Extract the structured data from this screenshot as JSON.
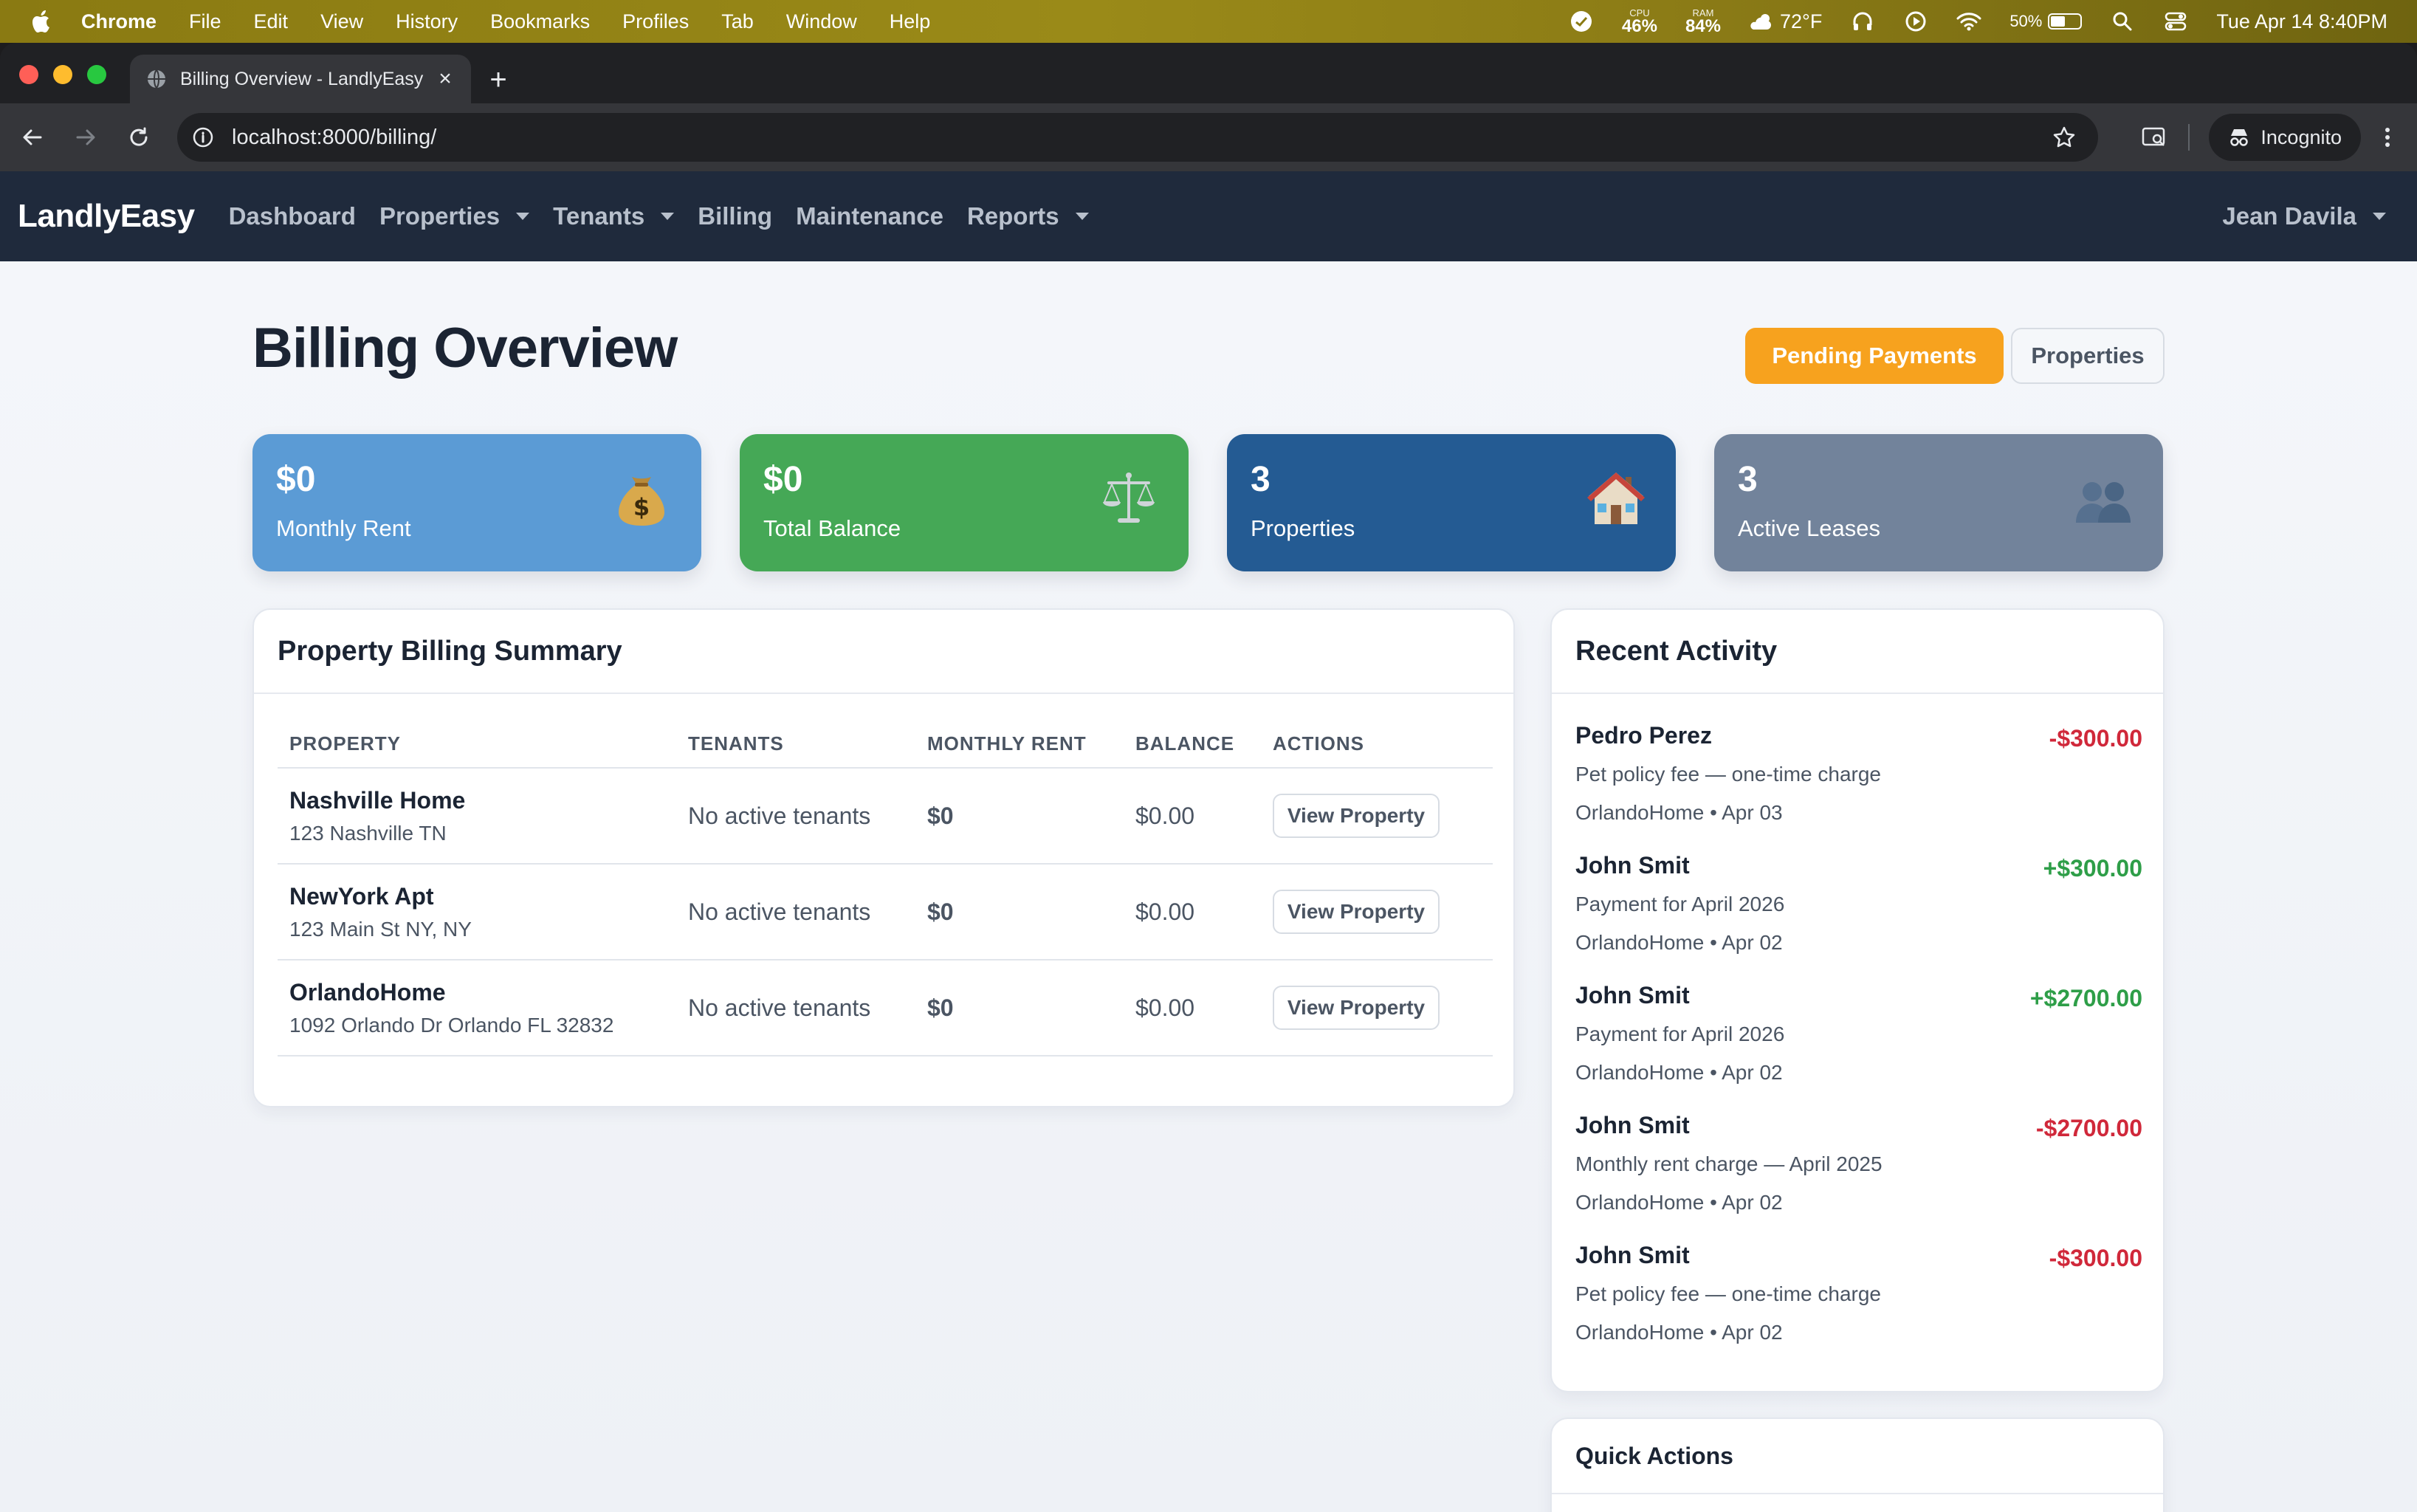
{
  "menubar": {
    "app": "Chrome",
    "items": [
      "File",
      "Edit",
      "View",
      "History",
      "Bookmarks",
      "Profiles",
      "Tab",
      "Window",
      "Help"
    ],
    "cpu_label": "CPU",
    "cpu_value": "46%",
    "ram_label": "RAM",
    "ram_value": "84%",
    "weather": "72°F",
    "battery": "50%",
    "battery_level": 0.5,
    "clock": "Tue Apr 14  8:40PM"
  },
  "browser": {
    "tab_title": "Billing Overview - LandlyEasy",
    "url": "localhost:8000/billing/",
    "incognito_label": "Incognito"
  },
  "nav": {
    "brand": "LandlyEasy",
    "links": {
      "dashboard": "Dashboard",
      "properties": "Properties",
      "tenants": "Tenants",
      "billing": "Billing",
      "maintenance": "Maintenance",
      "reports": "Reports"
    },
    "user": "Jean Davila"
  },
  "page": {
    "title": "Billing Overview",
    "pending_button": "Pending Payments",
    "properties_button": "Properties"
  },
  "stats": {
    "monthly_rent": {
      "value": "$0",
      "label": "Monthly Rent",
      "icon": "money-bag-icon"
    },
    "total_balance": {
      "value": "$0",
      "label": "Total Balance",
      "icon": "scales-icon"
    },
    "properties": {
      "value": "3",
      "label": "Properties",
      "icon": "house-icon"
    },
    "active_leases": {
      "value": "3",
      "label": "Active Leases",
      "icon": "people-icon"
    }
  },
  "summary": {
    "title": "Property Billing Summary",
    "columns": [
      "PROPERTY",
      "TENANTS",
      "MONTHLY RENT",
      "BALANCE",
      "ACTIONS"
    ],
    "rows": [
      {
        "name": "Nashville Home",
        "address": "123 Nashville TN",
        "tenants": "No active tenants",
        "rent": "$0",
        "balance": "$0.00",
        "action": "View Property"
      },
      {
        "name": "NewYork Apt",
        "address": "123 Main St NY, NY",
        "tenants": "No active tenants",
        "rent": "$0",
        "balance": "$0.00",
        "action": "View Property"
      },
      {
        "name": "OrlandoHome",
        "address": "1092 Orlando Dr Orlando FL 32832",
        "tenants": "No active tenants",
        "rent": "$0",
        "balance": "$0.00",
        "action": "View Property"
      }
    ]
  },
  "activity": {
    "title": "Recent Activity",
    "items": [
      {
        "who": "Pedro Perez",
        "desc": "Pet policy fee — one-time charge",
        "meta": "OrlandoHome • Apr 03",
        "amount": "-$300.00",
        "sign": "neg"
      },
      {
        "who": "John Smit",
        "desc": "Payment for April 2026",
        "meta": "OrlandoHome • Apr 02",
        "amount": "+$300.00",
        "sign": "pos"
      },
      {
        "who": "John Smit",
        "desc": "Payment for April 2026",
        "meta": "OrlandoHome • Apr 02",
        "amount": "+$2700.00",
        "sign": "pos"
      },
      {
        "who": "John Smit",
        "desc": "Monthly rent charge — April 2025",
        "meta": "OrlandoHome • Apr 02",
        "amount": "-$2700.00",
        "sign": "neg"
      },
      {
        "who": "John Smit",
        "desc": "Pet policy fee — one-time charge",
        "meta": "OrlandoHome • Apr 02",
        "amount": "-$300.00",
        "sign": "neg"
      }
    ]
  },
  "quick_actions": {
    "title": "Quick Actions"
  },
  "colors": {
    "nav_bg": "#1f2a3c",
    "accent_orange": "#f7a21e",
    "stat_blue": "#5b9bd5",
    "stat_green": "#45a856",
    "stat_navy": "#245b93",
    "stat_gray": "#72839b",
    "negative": "#d0283a",
    "positive": "#2e9e48"
  }
}
